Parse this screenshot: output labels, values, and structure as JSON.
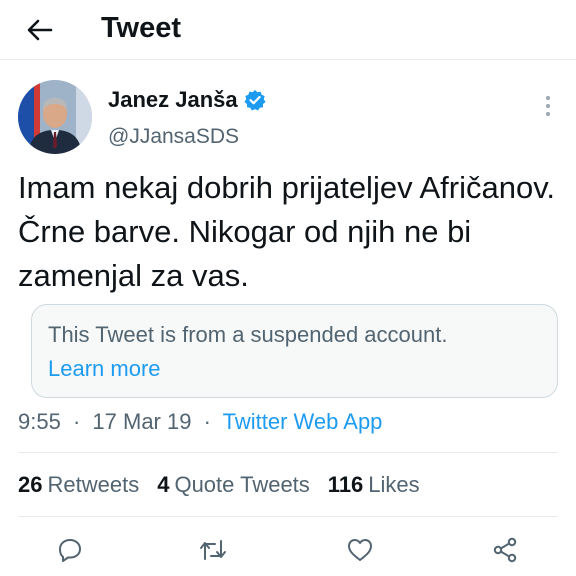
{
  "header": {
    "title": "Tweet",
    "back_icon": "arrow-left-icon"
  },
  "author": {
    "name": "Janez Janša",
    "handle": "@JJansaSDS",
    "verified": true,
    "verified_color": "#1d9bf0"
  },
  "tweet": {
    "text": "Imam nekaj dobrih prijateljev Afričanov. Črne barve. Nikogar od njih ne bi zamenjal za vas."
  },
  "notice": {
    "text": "This Tweet is from a suspended account.",
    "link": "Learn more"
  },
  "meta": {
    "time": "9:55",
    "date": "17 Mar 19",
    "separator": "·",
    "source": "Twitter Web App"
  },
  "stats": [
    {
      "count": "26",
      "label": "Retweets"
    },
    {
      "count": "4",
      "label": "Quote Tweets"
    },
    {
      "count": "116",
      "label": "Likes"
    }
  ],
  "actions": [
    "reply-icon",
    "retweet-icon",
    "like-icon",
    "share-icon"
  ],
  "colors": {
    "accent": "#1d9bf0",
    "text": "#0f1419",
    "secondary": "#536471",
    "border": "#e6ecf0"
  }
}
